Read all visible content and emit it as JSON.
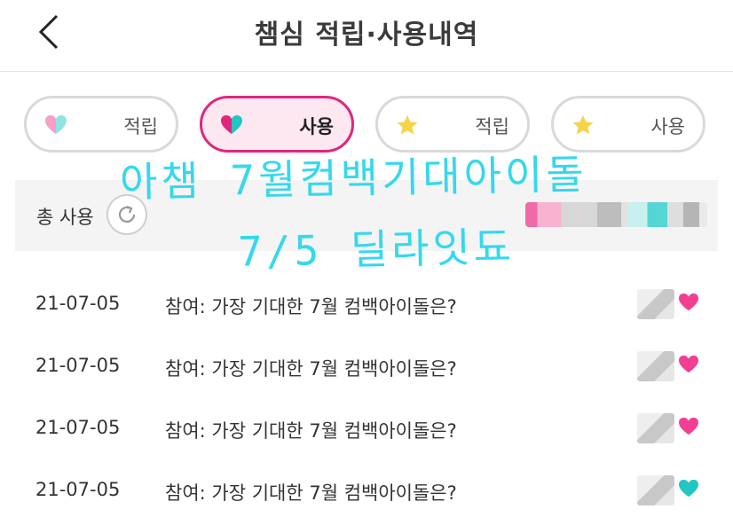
{
  "header": {
    "title": "챔심 적립·사용내역"
  },
  "tabs": [
    {
      "label": "적립",
      "icon": "heart-icon",
      "active": false
    },
    {
      "label": "사용",
      "icon": "heart-icon",
      "active": true
    },
    {
      "label": "적립",
      "icon": "star-icon",
      "active": false
    },
    {
      "label": "사용",
      "icon": "star-icon",
      "active": false
    }
  ],
  "summary": {
    "label": "총 사용"
  },
  "rows": [
    {
      "date": "21-07-05",
      "description": "참여: 가장 기대한 7월 컴백아이돌은?",
      "heart_color": "#f23f94"
    },
    {
      "date": "21-07-05",
      "description": "참여: 가장 기대한 7월 컴백아이돌은?",
      "heart_color": "#f23f94"
    },
    {
      "date": "21-07-05",
      "description": "참여: 가장 기대한 7월 컴백아이돌은?",
      "heart_color": "#f23f94"
    },
    {
      "date": "21-07-05",
      "description": "참여: 가장 기대한 7월 컴백아이돌은?",
      "heart_color": "#22c6c2"
    }
  ],
  "handwriting": {
    "line1": "아챔 7월컴백기대아이돌",
    "line2": "7/5 딜라잇됴"
  },
  "colors": {
    "accent": "#e0267d",
    "active_tab_bg": "#fde7f0",
    "handwriting": "#35d8ec",
    "star": "#f7d34a"
  }
}
